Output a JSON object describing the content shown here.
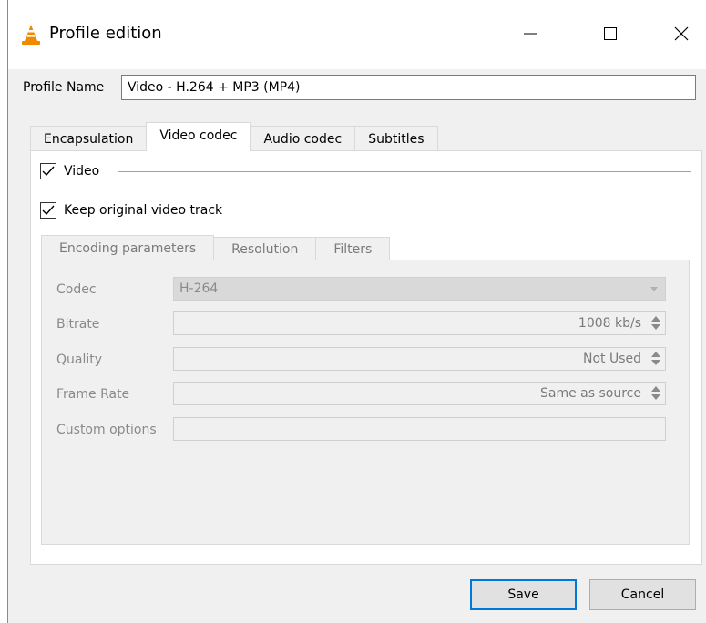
{
  "window": {
    "title": "Profile edition",
    "icon": "vlc-cone-icon"
  },
  "profile": {
    "label": "Profile Name",
    "value": "Video - H.264 + MP3 (MP4)"
  },
  "tabs": [
    {
      "label": "Encapsulation",
      "active": false
    },
    {
      "label": "Video codec",
      "active": true
    },
    {
      "label": "Audio codec",
      "active": false
    },
    {
      "label": "Subtitles",
      "active": false
    }
  ],
  "video": {
    "video_checkbox_label": "Video",
    "video_checked": true,
    "keep_original_label": "Keep original video track",
    "keep_original_checked": true
  },
  "subtabs": [
    {
      "label": "Encoding parameters",
      "active": true
    },
    {
      "label": "Resolution",
      "active": false
    },
    {
      "label": "Filters",
      "active": false
    }
  ],
  "encoding": {
    "codec_label": "Codec",
    "codec_value": "H-264",
    "bitrate_label": "Bitrate",
    "bitrate_value": "1008 kb/s",
    "quality_label": "Quality",
    "quality_value": "Not Used",
    "framerate_label": "Frame Rate",
    "framerate_value": "Same as source",
    "custom_label": "Custom options",
    "custom_value": ""
  },
  "buttons": {
    "save": "Save",
    "cancel": "Cancel"
  },
  "colors": {
    "accent": "#0078d7",
    "vlc_orange": "#f08a00"
  }
}
